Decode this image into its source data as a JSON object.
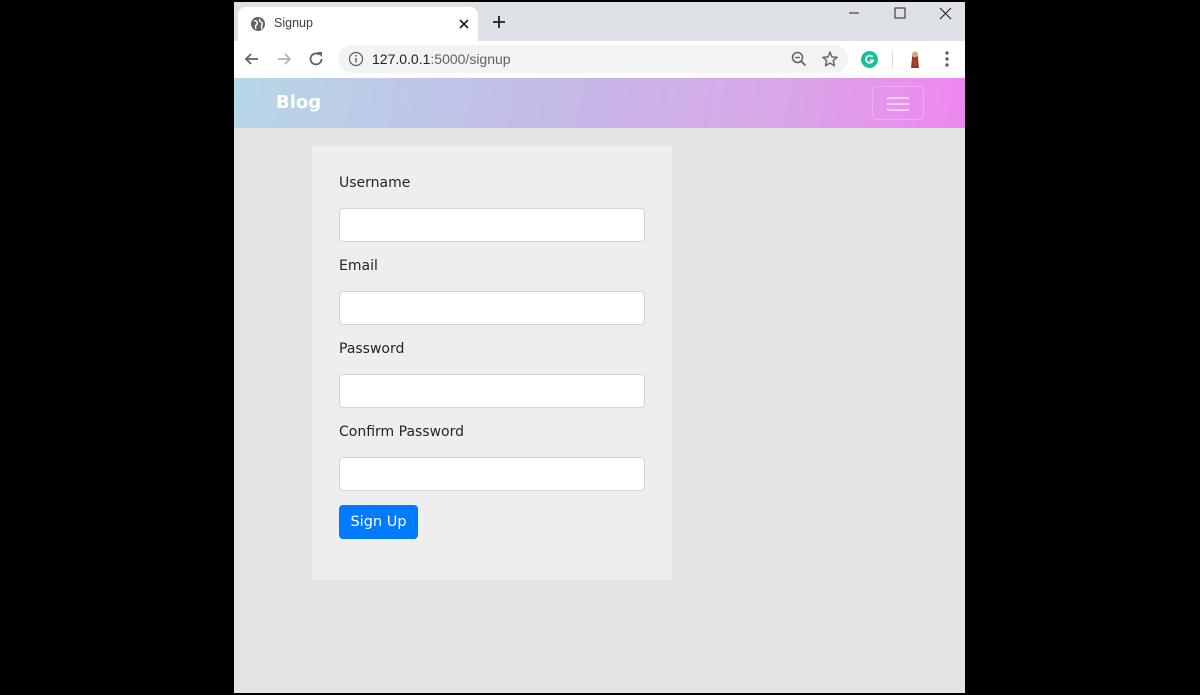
{
  "browser": {
    "tab_title": "Signup",
    "url_host": "127.0.0.1",
    "url_rest": ":5000/signup"
  },
  "navbar": {
    "brand": "Blog"
  },
  "form": {
    "fields": [
      {
        "label": "Username",
        "value": ""
      },
      {
        "label": "Email",
        "value": ""
      },
      {
        "label": "Password",
        "value": ""
      },
      {
        "label": "Confirm Password",
        "value": ""
      }
    ],
    "submit_label": "Sign Up"
  },
  "colors": {
    "primary_button": "#007bff",
    "navbar_gradient_start": "#b7d8e6",
    "navbar_gradient_end": "#ef86ef",
    "page_background": "#e4e4e4",
    "card_background": "#eeeeee"
  }
}
